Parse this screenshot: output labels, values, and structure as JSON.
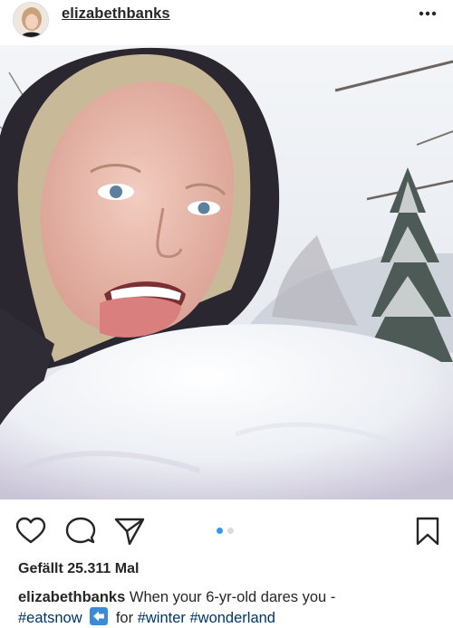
{
  "header": {
    "username": "elizabethbanks",
    "more_icon": "more-horizontal-icon"
  },
  "photo": {
    "pager_total": 2,
    "pager_active": 1,
    "pager_active_color": "#3897f0",
    "pager_inactive_color": "#dbdbdb"
  },
  "actions": {
    "like_icon": "heart-icon",
    "comment_icon": "comment-icon",
    "share_icon": "send-icon",
    "save_icon": "bookmark-icon"
  },
  "likes": {
    "text": "Gefällt 25.311 Mal"
  },
  "caption": {
    "username": "elizabethbanks",
    "text_1": "When your 6-yr-old dares you -",
    "hashtag_1": "#eatsnow",
    "emoji": "left-arrow-emoji-icon",
    "text_2": "for",
    "hashtag_2": "#winter",
    "hashtag_3": "#wonderland"
  }
}
